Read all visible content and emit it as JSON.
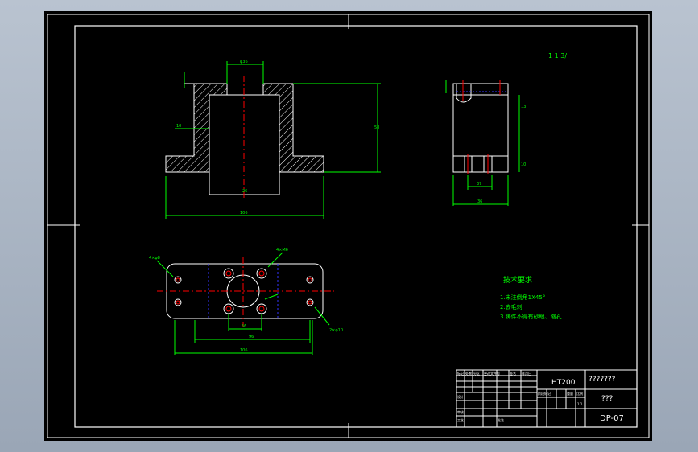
{
  "colors": {
    "frame": "#ffffff",
    "outline": "#ffffff",
    "dimension": "#00ff00",
    "centerline": "#ff0000",
    "hidden": "#3333ff",
    "hatch": "#ffffff",
    "note_text": "#00ff00"
  },
  "views": {
    "roughness_note": "1 1 3/",
    "front": {
      "dim_top_width": "φ36",
      "dim_height": "58",
      "dim_bore": "26",
      "dim_overall_width": "106",
      "dim_left": "10"
    },
    "side": {
      "dim_slot": "37",
      "dim_width": "36",
      "dim_top": "13",
      "dim_bottom": "10"
    },
    "plan": {
      "dim_center": "56",
      "dim_span": "96",
      "dim_overall": "106",
      "hole_note_left": "4×φ8",
      "hole_note_mid": "4×M6",
      "hole_note_right": "2×φ10"
    }
  },
  "technical_requirements": {
    "title": "技术要求",
    "items": [
      "1.未注倒角1X45°",
      "2.去毛刺",
      "3.铸件不得有砂眼、缩孔"
    ]
  },
  "title_block": {
    "material": "HT200",
    "company": "???????",
    "part_name": "???",
    "drawing_no": "DP-07",
    "scale": "1:1",
    "cells": [
      "标记",
      "处数",
      "分区",
      "更改文件号",
      "签名",
      "年月日",
      "设计",
      "审核",
      "工艺",
      "批准",
      "阶段标记",
      "重量",
      "比例"
    ]
  }
}
